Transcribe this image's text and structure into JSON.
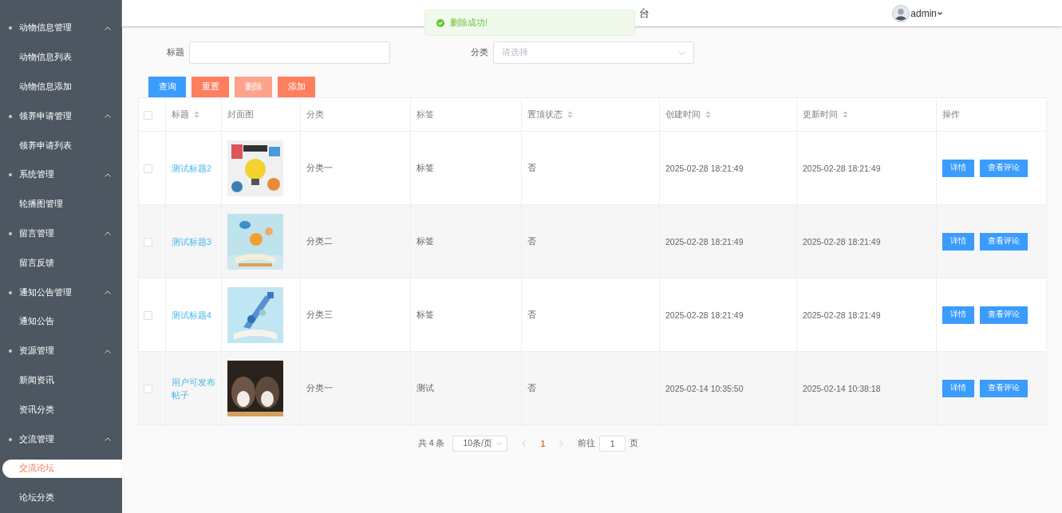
{
  "sidebar": {
    "items": [
      {
        "kind": "group",
        "label": "动物信息管理",
        "expanded": true,
        "children": [
          {
            "label": "动物信息列表",
            "selected": false
          },
          {
            "label": "动物信息添加",
            "selected": false
          }
        ]
      },
      {
        "kind": "group",
        "label": "领养申请管理",
        "expanded": true,
        "children": [
          {
            "label": "领养申请列表",
            "selected": false
          }
        ]
      },
      {
        "kind": "group",
        "label": "系统管理",
        "expanded": true,
        "children": [
          {
            "label": "轮播图管理",
            "selected": false
          }
        ]
      },
      {
        "kind": "group",
        "label": "留言管理",
        "expanded": true,
        "children": [
          {
            "label": "留言反馈",
            "selected": false
          }
        ]
      },
      {
        "kind": "group",
        "label": "通知公告管理",
        "expanded": true,
        "children": [
          {
            "label": "通知公告",
            "selected": false
          }
        ]
      },
      {
        "kind": "group",
        "label": "资源管理",
        "expanded": true,
        "children": [
          {
            "label": "新闻资讯",
            "selected": false
          },
          {
            "label": "资讯分类",
            "selected": false
          }
        ]
      },
      {
        "kind": "group",
        "label": "交流管理",
        "expanded": true,
        "children": [
          {
            "label": "交流论坛",
            "selected": true
          },
          {
            "label": "论坛分类",
            "selected": false
          }
        ]
      }
    ]
  },
  "header": {
    "title": "台",
    "user": "admin"
  },
  "toast": {
    "message": "删除成功!"
  },
  "filters": [
    {
      "kind": "input",
      "label": "标题"
    },
    {
      "kind": "select",
      "label": "分类",
      "placeholder": "请选择"
    }
  ],
  "actions": [
    {
      "label": "查询",
      "kind": "primary",
      "disabled": false
    },
    {
      "label": "重置",
      "kind": "danger",
      "disabled": false
    },
    {
      "label": "删除",
      "kind": "danger",
      "disabled": true
    },
    {
      "label": "添加",
      "kind": "danger",
      "disabled": false
    }
  ],
  "table": {
    "columns": [
      {
        "label": "标题",
        "sortable": true
      },
      {
        "label": "封面图",
        "sortable": false
      },
      {
        "label": "分类",
        "sortable": false
      },
      {
        "label": "标签",
        "sortable": false
      },
      {
        "label": "置顶状态",
        "sortable": true
      },
      {
        "label": "创建时间",
        "sortable": true
      },
      {
        "label": "更新时间",
        "sortable": true
      },
      {
        "label": "操作",
        "sortable": false
      }
    ],
    "all_checked": false,
    "rows": [
      {
        "checked": false,
        "title": "测试标题2",
        "category": "分类一",
        "tag": "标签",
        "pinned": "否",
        "created": "2025-02-28 18:21:49",
        "updated": "2025-02-28 18:21:49",
        "buttons": [
          "详情",
          "查看评论"
        ]
      },
      {
        "checked": false,
        "title": "测试标题3",
        "category": "分类二",
        "tag": "标签",
        "pinned": "否",
        "created": "2025-02-28 18:21:49",
        "updated": "2025-02-28 18:21:49",
        "buttons": [
          "详情",
          "查看评论"
        ]
      },
      {
        "checked": false,
        "title": "测试标题4",
        "category": "分类三",
        "tag": "标签",
        "pinned": "否",
        "created": "2025-02-28 18:21:49",
        "updated": "2025-02-28 18:21:49",
        "buttons": [
          "详情",
          "查看评论"
        ]
      },
      {
        "checked": false,
        "title": "用户可发布帖子",
        "category": "分类一",
        "tag": "测试",
        "pinned": "否",
        "created": "2025-02-14 10:35:50",
        "updated": "2025-02-14 10:38:18",
        "buttons": [
          "详情",
          "查看评论"
        ]
      }
    ]
  },
  "pagination": {
    "total": "共 4 条",
    "page_size": "10条/页",
    "pages": [
      {
        "label": "1",
        "selected": true
      }
    ],
    "goto_label": "前往",
    "goto_value": "1",
    "page_suffix": "页"
  }
}
